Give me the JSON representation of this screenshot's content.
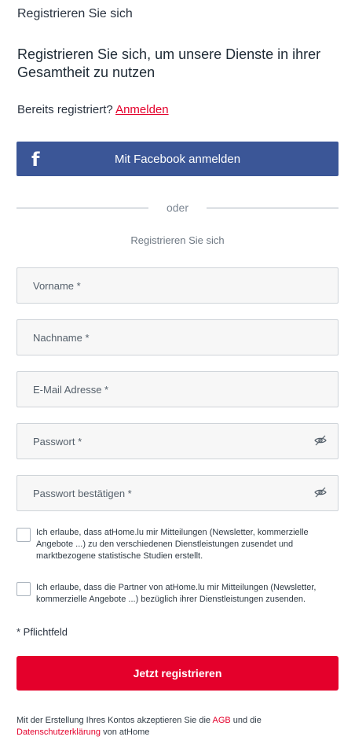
{
  "header": {
    "title": "Registrieren Sie sich",
    "subtitle": "Registrieren Sie sich, um unsere Dienste in ihrer Gesamtheit zu nutzen"
  },
  "login": {
    "prompt": "Bereits registriert?",
    "link_label": "Anmelden"
  },
  "facebook": {
    "icon_glyph": "f",
    "label": "Mit Facebook anmelden",
    "color": "#3b5697"
  },
  "divider": {
    "label": "oder"
  },
  "form": {
    "section_label": "Registrieren Sie sich",
    "fields": {
      "firstname_placeholder": "Vorname *",
      "lastname_placeholder": "Nachname *",
      "email_placeholder": "E-Mail Adresse *",
      "password_placeholder": "Passwort *",
      "password_confirm_placeholder": "Passwort bestätigen *"
    },
    "consents": {
      "athome_text": "Ich erlaube, dass atHome.lu mir Mitteilungen (Newsletter, kommerzielle Angebote ...) zu den verschiedenen Dienstleistungen zusendet und marktbezogene statistische Studien erstellt.",
      "partners_text": "Ich erlaube, dass die Partner von atHome.lu mir Mitteilungen (Newsletter, kommerzielle Angebote ...) bezüglich ihrer Dienstleistungen zusenden."
    },
    "required_note": "* Pflichtfeld",
    "submit_label": "Jetzt registrieren",
    "submit_color": "#e4002b"
  },
  "legal": {
    "prefix": "Mit der Erstellung Ihres Kontos akzeptieren Sie die",
    "agb_link": "AGB",
    "middle": "und die",
    "privacy_link": "Datenschutzerklärung",
    "suffix": "von atHome"
  }
}
